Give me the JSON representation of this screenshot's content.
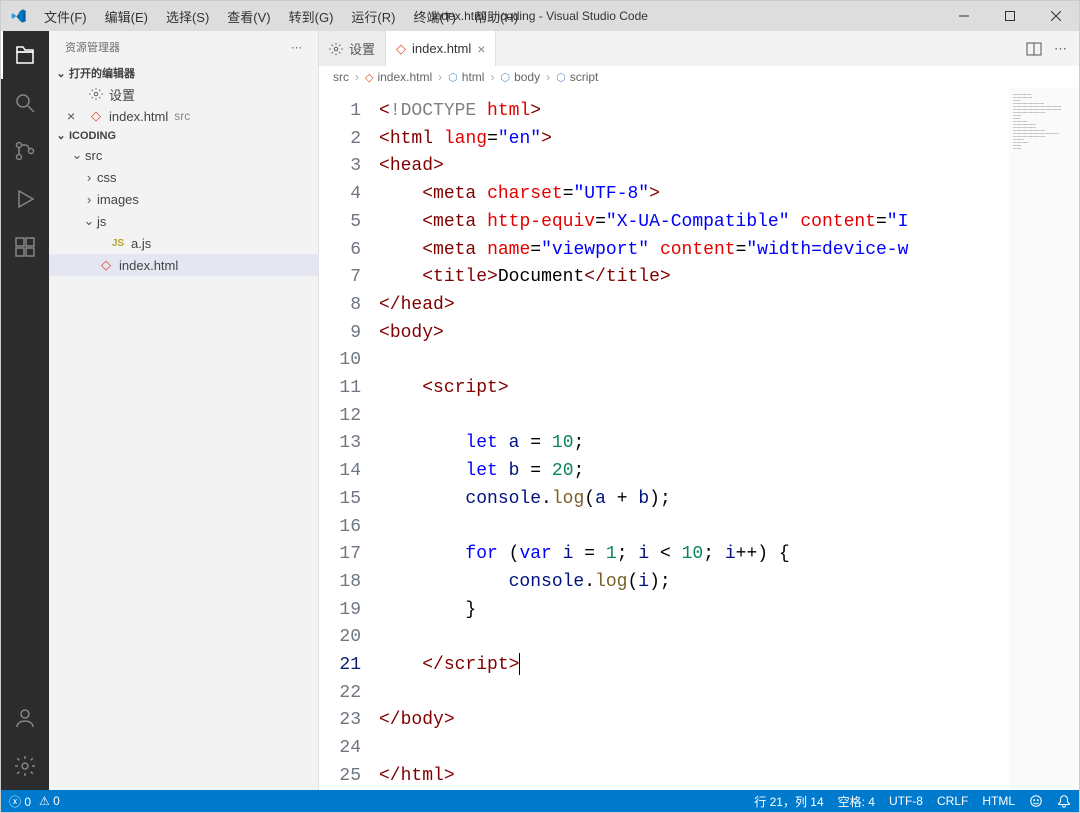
{
  "title": "index.html - icoding - Visual Studio Code",
  "menu": [
    "文件(F)",
    "编辑(E)",
    "选择(S)",
    "查看(V)",
    "转到(G)",
    "运行(R)",
    "终端(T)",
    "帮助(H)"
  ],
  "sidebar": {
    "title": "资源管理器",
    "openEditors": "打开的编辑器",
    "openItems": [
      {
        "label": "设置",
        "type": "gear"
      },
      {
        "label": "index.html",
        "type": "html",
        "desc": "src",
        "close": true
      }
    ],
    "project": "ICODING",
    "tree": [
      {
        "label": "src",
        "indent": 1,
        "chev": "v"
      },
      {
        "label": "css",
        "indent": 2,
        "chev": ">"
      },
      {
        "label": "images",
        "indent": 2,
        "chev": ">"
      },
      {
        "label": "js",
        "indent": 2,
        "chev": "v"
      },
      {
        "label": "a.js",
        "indent": 3,
        "icon": "js"
      },
      {
        "label": "index.html",
        "indent": 2,
        "icon": "html",
        "active": true
      }
    ]
  },
  "tabs": [
    {
      "label": "设置",
      "icon": "gear"
    },
    {
      "label": "index.html",
      "icon": "html",
      "active": true
    }
  ],
  "breadcrumbs": [
    "src",
    "index.html",
    "html",
    "body",
    "script"
  ],
  "code": {
    "lines": 25,
    "currentLine": 21
  },
  "codeLines": [
    [
      [
        "ang",
        "<"
      ],
      [
        "doctype",
        "!DOCTYPE"
      ],
      [
        "text",
        " "
      ],
      [
        "attr",
        "html"
      ],
      [
        "ang",
        ">"
      ]
    ],
    [
      [
        "ang",
        "<"
      ],
      [
        "tag",
        "html"
      ],
      [
        "text",
        " "
      ],
      [
        "attr",
        "lang"
      ],
      [
        "punc",
        "="
      ],
      [
        "string",
        "\"en\""
      ],
      [
        "ang",
        ">"
      ]
    ],
    [
      [
        "ang",
        "<"
      ],
      [
        "tag",
        "head"
      ],
      [
        "ang",
        ">"
      ]
    ],
    [
      [
        "text",
        "    "
      ],
      [
        "ang",
        "<"
      ],
      [
        "tag",
        "meta"
      ],
      [
        "text",
        " "
      ],
      [
        "attr",
        "charset"
      ],
      [
        "punc",
        "="
      ],
      [
        "string",
        "\"UTF-8\""
      ],
      [
        "ang",
        ">"
      ]
    ],
    [
      [
        "text",
        "    "
      ],
      [
        "ang",
        "<"
      ],
      [
        "tag",
        "meta"
      ],
      [
        "text",
        " "
      ],
      [
        "attr",
        "http-equiv"
      ],
      [
        "punc",
        "="
      ],
      [
        "string",
        "\"X-UA-Compatible\""
      ],
      [
        "text",
        " "
      ],
      [
        "attr",
        "content"
      ],
      [
        "punc",
        "="
      ],
      [
        "string",
        "\"I"
      ]
    ],
    [
      [
        "text",
        "    "
      ],
      [
        "ang",
        "<"
      ],
      [
        "tag",
        "meta"
      ],
      [
        "text",
        " "
      ],
      [
        "attr",
        "name"
      ],
      [
        "punc",
        "="
      ],
      [
        "string",
        "\"viewport\""
      ],
      [
        "text",
        " "
      ],
      [
        "attr",
        "content"
      ],
      [
        "punc",
        "="
      ],
      [
        "string",
        "\"width=device-w"
      ]
    ],
    [
      [
        "text",
        "    "
      ],
      [
        "ang",
        "<"
      ],
      [
        "tag",
        "title"
      ],
      [
        "ang",
        ">"
      ],
      [
        "text",
        "Document"
      ],
      [
        "ang",
        "</"
      ],
      [
        "tag",
        "title"
      ],
      [
        "ang",
        ">"
      ]
    ],
    [
      [
        "ang",
        "</"
      ],
      [
        "tag",
        "head"
      ],
      [
        "ang",
        ">"
      ]
    ],
    [
      [
        "ang",
        "<"
      ],
      [
        "tag",
        "body"
      ],
      [
        "ang",
        ">"
      ]
    ],
    [],
    [
      [
        "text",
        "    "
      ],
      [
        "ang",
        "<"
      ],
      [
        "tag",
        "script"
      ],
      [
        "ang",
        ">"
      ]
    ],
    [],
    [
      [
        "text",
        "        "
      ],
      [
        "kw",
        "let"
      ],
      [
        "text",
        " "
      ],
      [
        "var",
        "a"
      ],
      [
        "text",
        " "
      ],
      [
        "punc",
        "="
      ],
      [
        "text",
        " "
      ],
      [
        "num",
        "10"
      ],
      [
        "punc",
        ";"
      ]
    ],
    [
      [
        "text",
        "        "
      ],
      [
        "kw",
        "let"
      ],
      [
        "text",
        " "
      ],
      [
        "var",
        "b"
      ],
      [
        "text",
        " "
      ],
      [
        "punc",
        "="
      ],
      [
        "text",
        " "
      ],
      [
        "num",
        "20"
      ],
      [
        "punc",
        ";"
      ]
    ],
    [
      [
        "text",
        "        "
      ],
      [
        "obj",
        "console"
      ],
      [
        "punc",
        "."
      ],
      [
        "func",
        "log"
      ],
      [
        "punc",
        "("
      ],
      [
        "var",
        "a"
      ],
      [
        "text",
        " "
      ],
      [
        "punc",
        "+"
      ],
      [
        "text",
        " "
      ],
      [
        "var",
        "b"
      ],
      [
        "punc",
        ")"
      ],
      [
        "punc",
        ";"
      ]
    ],
    [],
    [
      [
        "text",
        "        "
      ],
      [
        "kw",
        "for"
      ],
      [
        "text",
        " "
      ],
      [
        "punc",
        "("
      ],
      [
        "kw",
        "var"
      ],
      [
        "text",
        " "
      ],
      [
        "var",
        "i"
      ],
      [
        "text",
        " "
      ],
      [
        "punc",
        "="
      ],
      [
        "text",
        " "
      ],
      [
        "num",
        "1"
      ],
      [
        "punc",
        ";"
      ],
      [
        "text",
        " "
      ],
      [
        "var",
        "i"
      ],
      [
        "text",
        " "
      ],
      [
        "punc",
        "<"
      ],
      [
        "text",
        " "
      ],
      [
        "num",
        "10"
      ],
      [
        "punc",
        ";"
      ],
      [
        "text",
        " "
      ],
      [
        "var",
        "i"
      ],
      [
        "punc",
        "++"
      ],
      [
        "punc",
        ")"
      ],
      [
        "text",
        " "
      ],
      [
        "punc",
        "{"
      ]
    ],
    [
      [
        "text",
        "            "
      ],
      [
        "obj",
        "console"
      ],
      [
        "punc",
        "."
      ],
      [
        "func",
        "log"
      ],
      [
        "punc",
        "("
      ],
      [
        "var",
        "i"
      ],
      [
        "punc",
        ")"
      ],
      [
        "punc",
        ";"
      ]
    ],
    [
      [
        "text",
        "        "
      ],
      [
        "punc",
        "}"
      ]
    ],
    [],
    [
      [
        "text",
        "    "
      ],
      [
        "ang",
        "</"
      ],
      [
        "tag",
        "script"
      ],
      [
        "ang",
        ">"
      ],
      [
        "cursor",
        ""
      ]
    ],
    [],
    [
      [
        "ang",
        "</"
      ],
      [
        "tag",
        "body"
      ],
      [
        "ang",
        ">"
      ]
    ],
    [],
    [
      [
        "ang",
        "</"
      ],
      [
        "tag",
        "html"
      ],
      [
        "ang",
        ">"
      ]
    ]
  ],
  "status": {
    "errors": "0",
    "warnings": "0",
    "line": "行 21，列 14",
    "spaces": "空格: 4",
    "encoding": "UTF-8",
    "eol": "CRLF",
    "lang": "HTML"
  }
}
